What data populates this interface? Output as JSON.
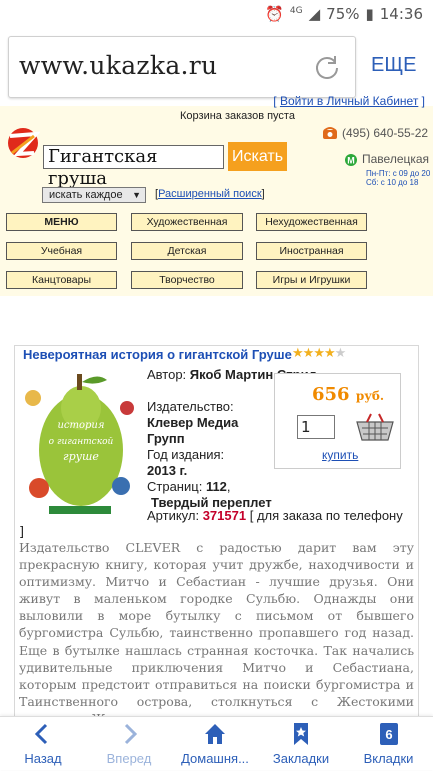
{
  "statusbar": {
    "network": "4G",
    "battery": "75%",
    "time": "14:36"
  },
  "browser": {
    "url": "www.ukazka.ru",
    "more_label": "ЕЩЕ"
  },
  "header": {
    "cabinet_link": "Войти в Личный Кабинет",
    "cart_text": "Корзина заказов пуста",
    "phone": "(495) 640-55-22",
    "metro": "Павелецкая",
    "hours_weekdays": "Пн-Пт: с 09 до 20",
    "hours_weekend": "Сб: с 10 до 18",
    "search_value": "Гигантская груша",
    "search_button": "Искать",
    "search_mode": "искать каждое",
    "advanced_search": "Расширенный поиск"
  },
  "menu": [
    "МЕНЮ",
    "Художественная",
    "Нехудожественная",
    "Учебная",
    "Детская",
    "Иностранная",
    "Канцтовары",
    "Творчество",
    "Игры и Игрушки"
  ],
  "product": {
    "title": "Невероятная история о гигантской Груше",
    "rating": 4.5,
    "author_label": "Автор:",
    "author": "Якоб Мартин Стрид",
    "publisher_label": "Издательство:",
    "publisher": "Клевер Медиа Групп",
    "year_label": "Год издания:",
    "year": "2013 г.",
    "pages_label": "Страниц:",
    "pages": "112",
    "binding": "Твердый переплет",
    "article_label": "Артикул:",
    "article": "371571",
    "article_note": "[ для заказа по телефону",
    "price": "656",
    "currency": "руб.",
    "quantity": "1",
    "buy_link": "купить",
    "description": "Издательство CLEVER с радостью дарит вам эту прекрасную книгу, которая учит дружбе, находчивости и оптимизму. Митчо и Себастиан - лучшие друзья. Они живут в маленьком городке Сульбю. Однажды они выловили в море бутылку с письмом от бывшего бургомистра Сульбю, таинственно пропавшего год назад. Еще в бутылке нашлась странная косточка. Так начались удивительные приключения Митчо и Себастиана, которым предстоит отправиться на поиски бургомистра и Таинственного острова, столкнуться с Жестокими пиратами, Жутким морским ..."
  },
  "bottom_nav": {
    "back": "Назад",
    "forward": "Вперед",
    "home": "Домашня...",
    "bookmarks": "Закладки",
    "tabs": "Вкладки",
    "tab_count": "6"
  },
  "colors": {
    "accent": "#2d5fb8",
    "search_button": "#f5a01e",
    "price": "#f08a00",
    "article": "#c4002a",
    "site_bg": "#fffbe6"
  }
}
